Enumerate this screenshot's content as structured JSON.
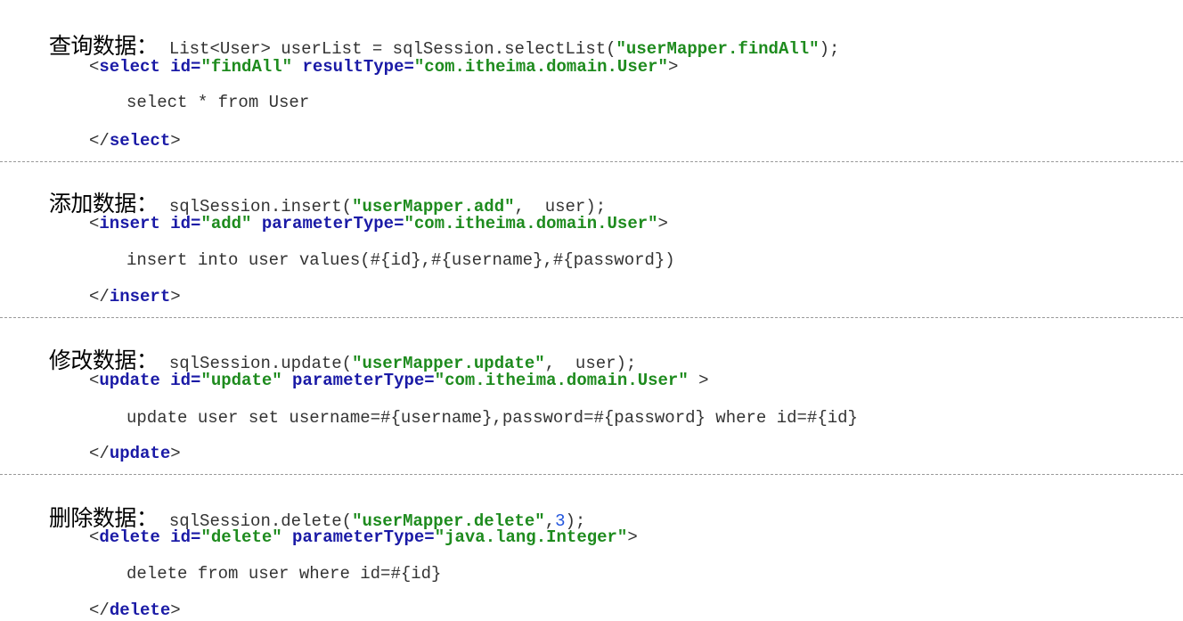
{
  "sections": [
    {
      "title": "查询数据",
      "colon": "：",
      "call_pre": "List<User> userList = sqlSession.selectList(",
      "call_str": "\"userMapper.findAll\"",
      "call_post": ");",
      "open_lt": "<",
      "tag": "select",
      "attr1_name": " id=",
      "attr1_val": "\"findAll\"",
      "attr2_name": " resultType=",
      "attr2_val": "\"com.itheima.domain.User\"",
      "open_gt": ">",
      "body": "select * from User",
      "close_lt": "</",
      "close_gt": ">"
    },
    {
      "title": "添加数据",
      "colon": "：",
      "call_pre": "sqlSession.insert(",
      "call_str": "\"userMapper.add\"",
      "call_post": ",  user);",
      "open_lt": "<",
      "tag": "insert",
      "attr1_name": " id=",
      "attr1_val": "\"add\"",
      "attr2_name": " parameterType=",
      "attr2_val": "\"com.itheima.domain.User\"",
      "open_gt": ">",
      "body": "insert into user values(#{id},#{username},#{password})",
      "close_lt": "</",
      "close_gt": ">"
    },
    {
      "title": "修改数据",
      "colon": "：",
      "call_pre": "sqlSession.update(",
      "call_str": "\"userMapper.update\"",
      "call_post": ",  user);",
      "open_lt": "<",
      "tag": "update",
      "attr1_name": " id=",
      "attr1_val": "\"update\"",
      "attr2_name": " parameterType=",
      "attr2_val": "\"com.itheima.domain.User\"",
      "open_gt": " >",
      "body": "update user set username=#{username},password=#{password} where id=#{id}",
      "close_lt": "</",
      "close_gt": ">"
    },
    {
      "title": "删除数据",
      "colon": "：",
      "call_pre": "sqlSession.delete(",
      "call_str": "\"userMapper.delete\"",
      "call_num_sep": ",",
      "call_num": "3",
      "call_post": ");",
      "open_lt": "<",
      "tag": "delete",
      "attr1_name": " id=",
      "attr1_val": "\"delete\"",
      "attr2_name": " parameterType=",
      "attr2_val": "\"java.lang.Integer\"",
      "open_gt": ">",
      "body": "delete from user where id=#{id}",
      "close_lt": "</",
      "close_gt": ">"
    }
  ],
  "colors": {
    "keyword": "#1a1aa6",
    "string": "#1e8b1e",
    "number": "#2255dd",
    "text": "#333333",
    "divider": "#9a9a9a"
  }
}
